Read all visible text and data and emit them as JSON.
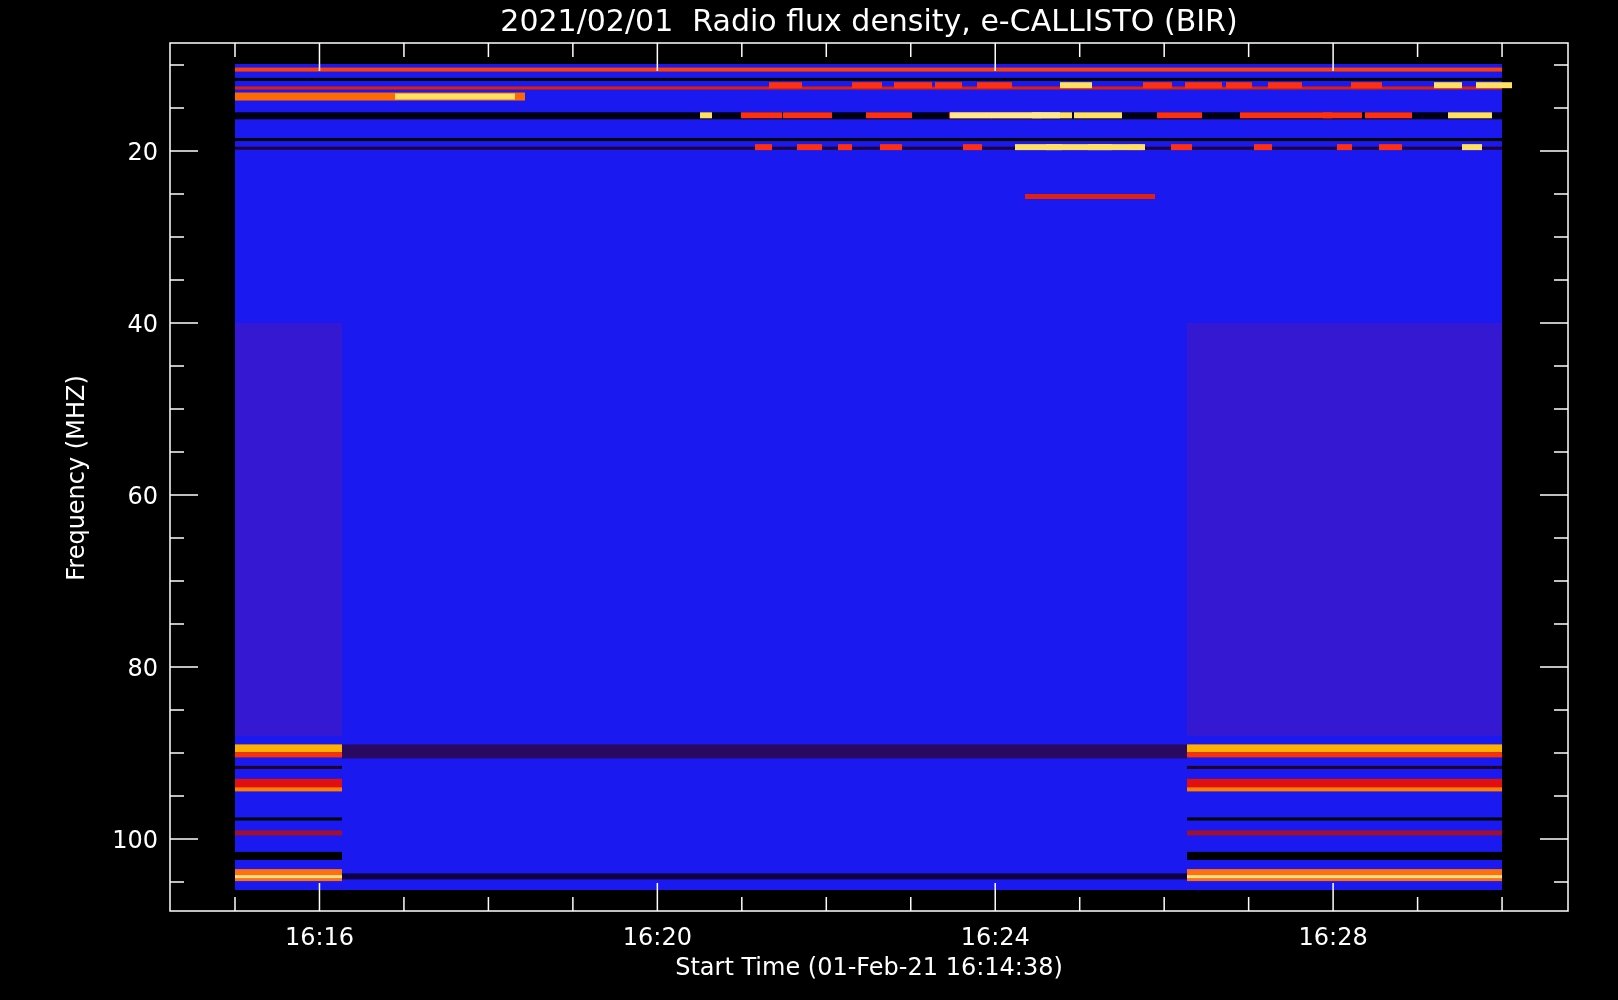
{
  "title": "2021/02/01  Radio flux density, e-CALLISTO (BIR)",
  "y_axis": {
    "label": "Frequency (MHZ)",
    "ticks": [
      "20",
      "40",
      "60",
      "80",
      "100"
    ]
  },
  "x_axis": {
    "label": "Start Time (01-Feb-21 16:14:38)",
    "ticks": [
      "16:16",
      "16:20",
      "16:24",
      "16:28"
    ]
  }
}
